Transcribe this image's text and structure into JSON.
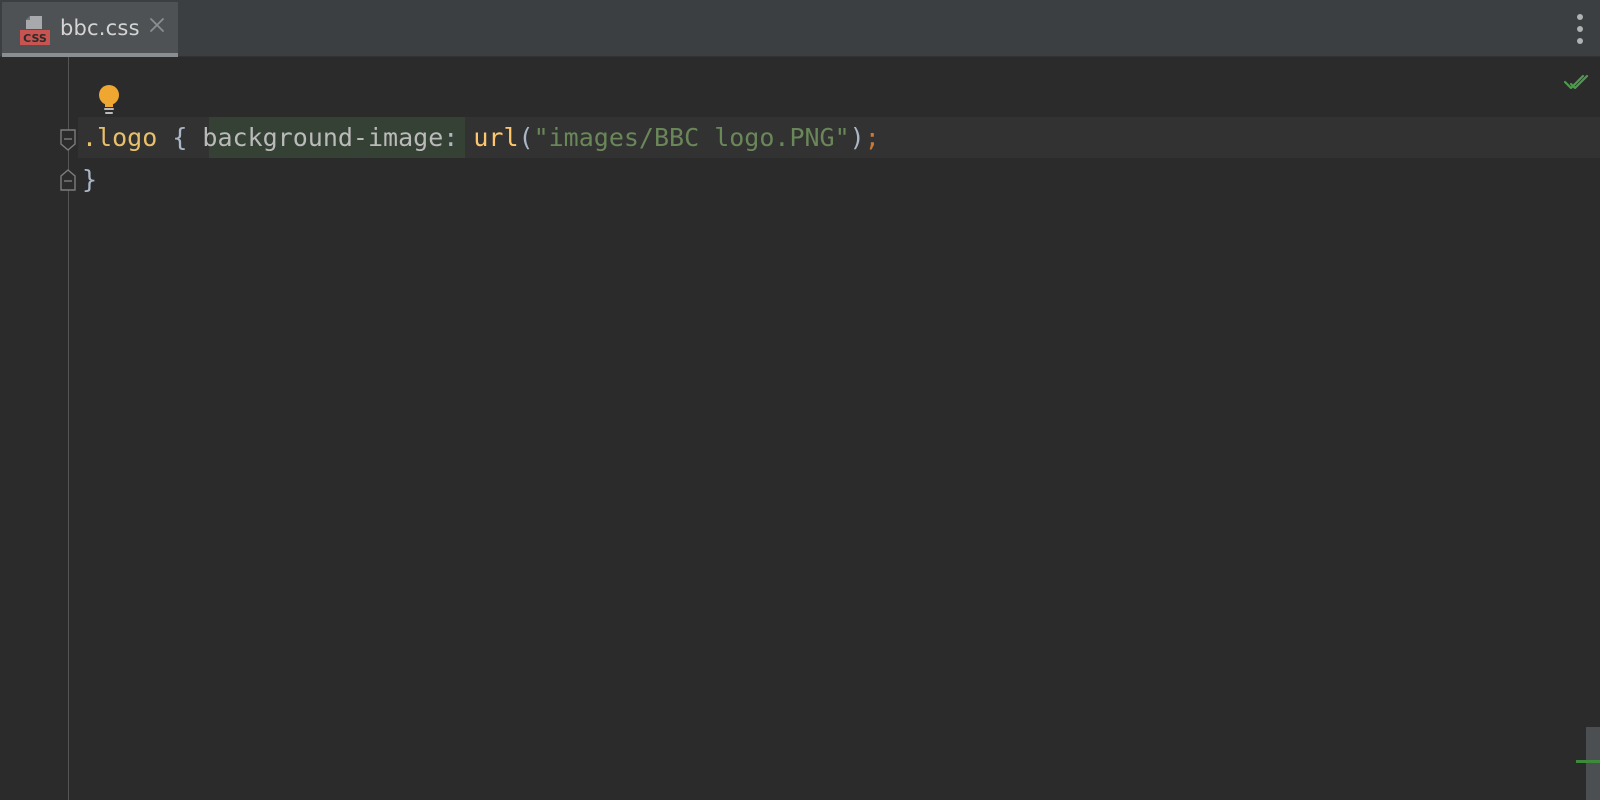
{
  "tabs": [
    {
      "label": "bbc.css",
      "icon": "css-file-icon",
      "icon_text": "CSS",
      "active": true
    }
  ],
  "toolbar": {
    "more_icon": "more-vertical-icon"
  },
  "editor": {
    "lines": [
      {
        "tokens": {
          "selector": ".logo",
          "brace_open": " { ",
          "property": "background-image",
          "colon": ": ",
          "function": "url",
          "paren_open": "(",
          "string": "\"images/BBC logo.PNG\"",
          "paren_close": ")",
          "semicolon": ";"
        }
      },
      {
        "tokens": {
          "brace_close": "}"
        }
      }
    ],
    "intention_icon": "lightbulb-icon",
    "inspection_status_icon": "checkmark-icon"
  },
  "colors": {
    "background": "#2b2b2b",
    "tabbar": "#3c3f41",
    "active_tab": "#4e5254",
    "selector": "#e8bf6a",
    "string": "#6a8759",
    "function": "#ffc66d",
    "keyword_punct": "#cc7832",
    "text": "#a9b7c6",
    "success": "#4e9a4e",
    "bulb": "#f0a732"
  }
}
